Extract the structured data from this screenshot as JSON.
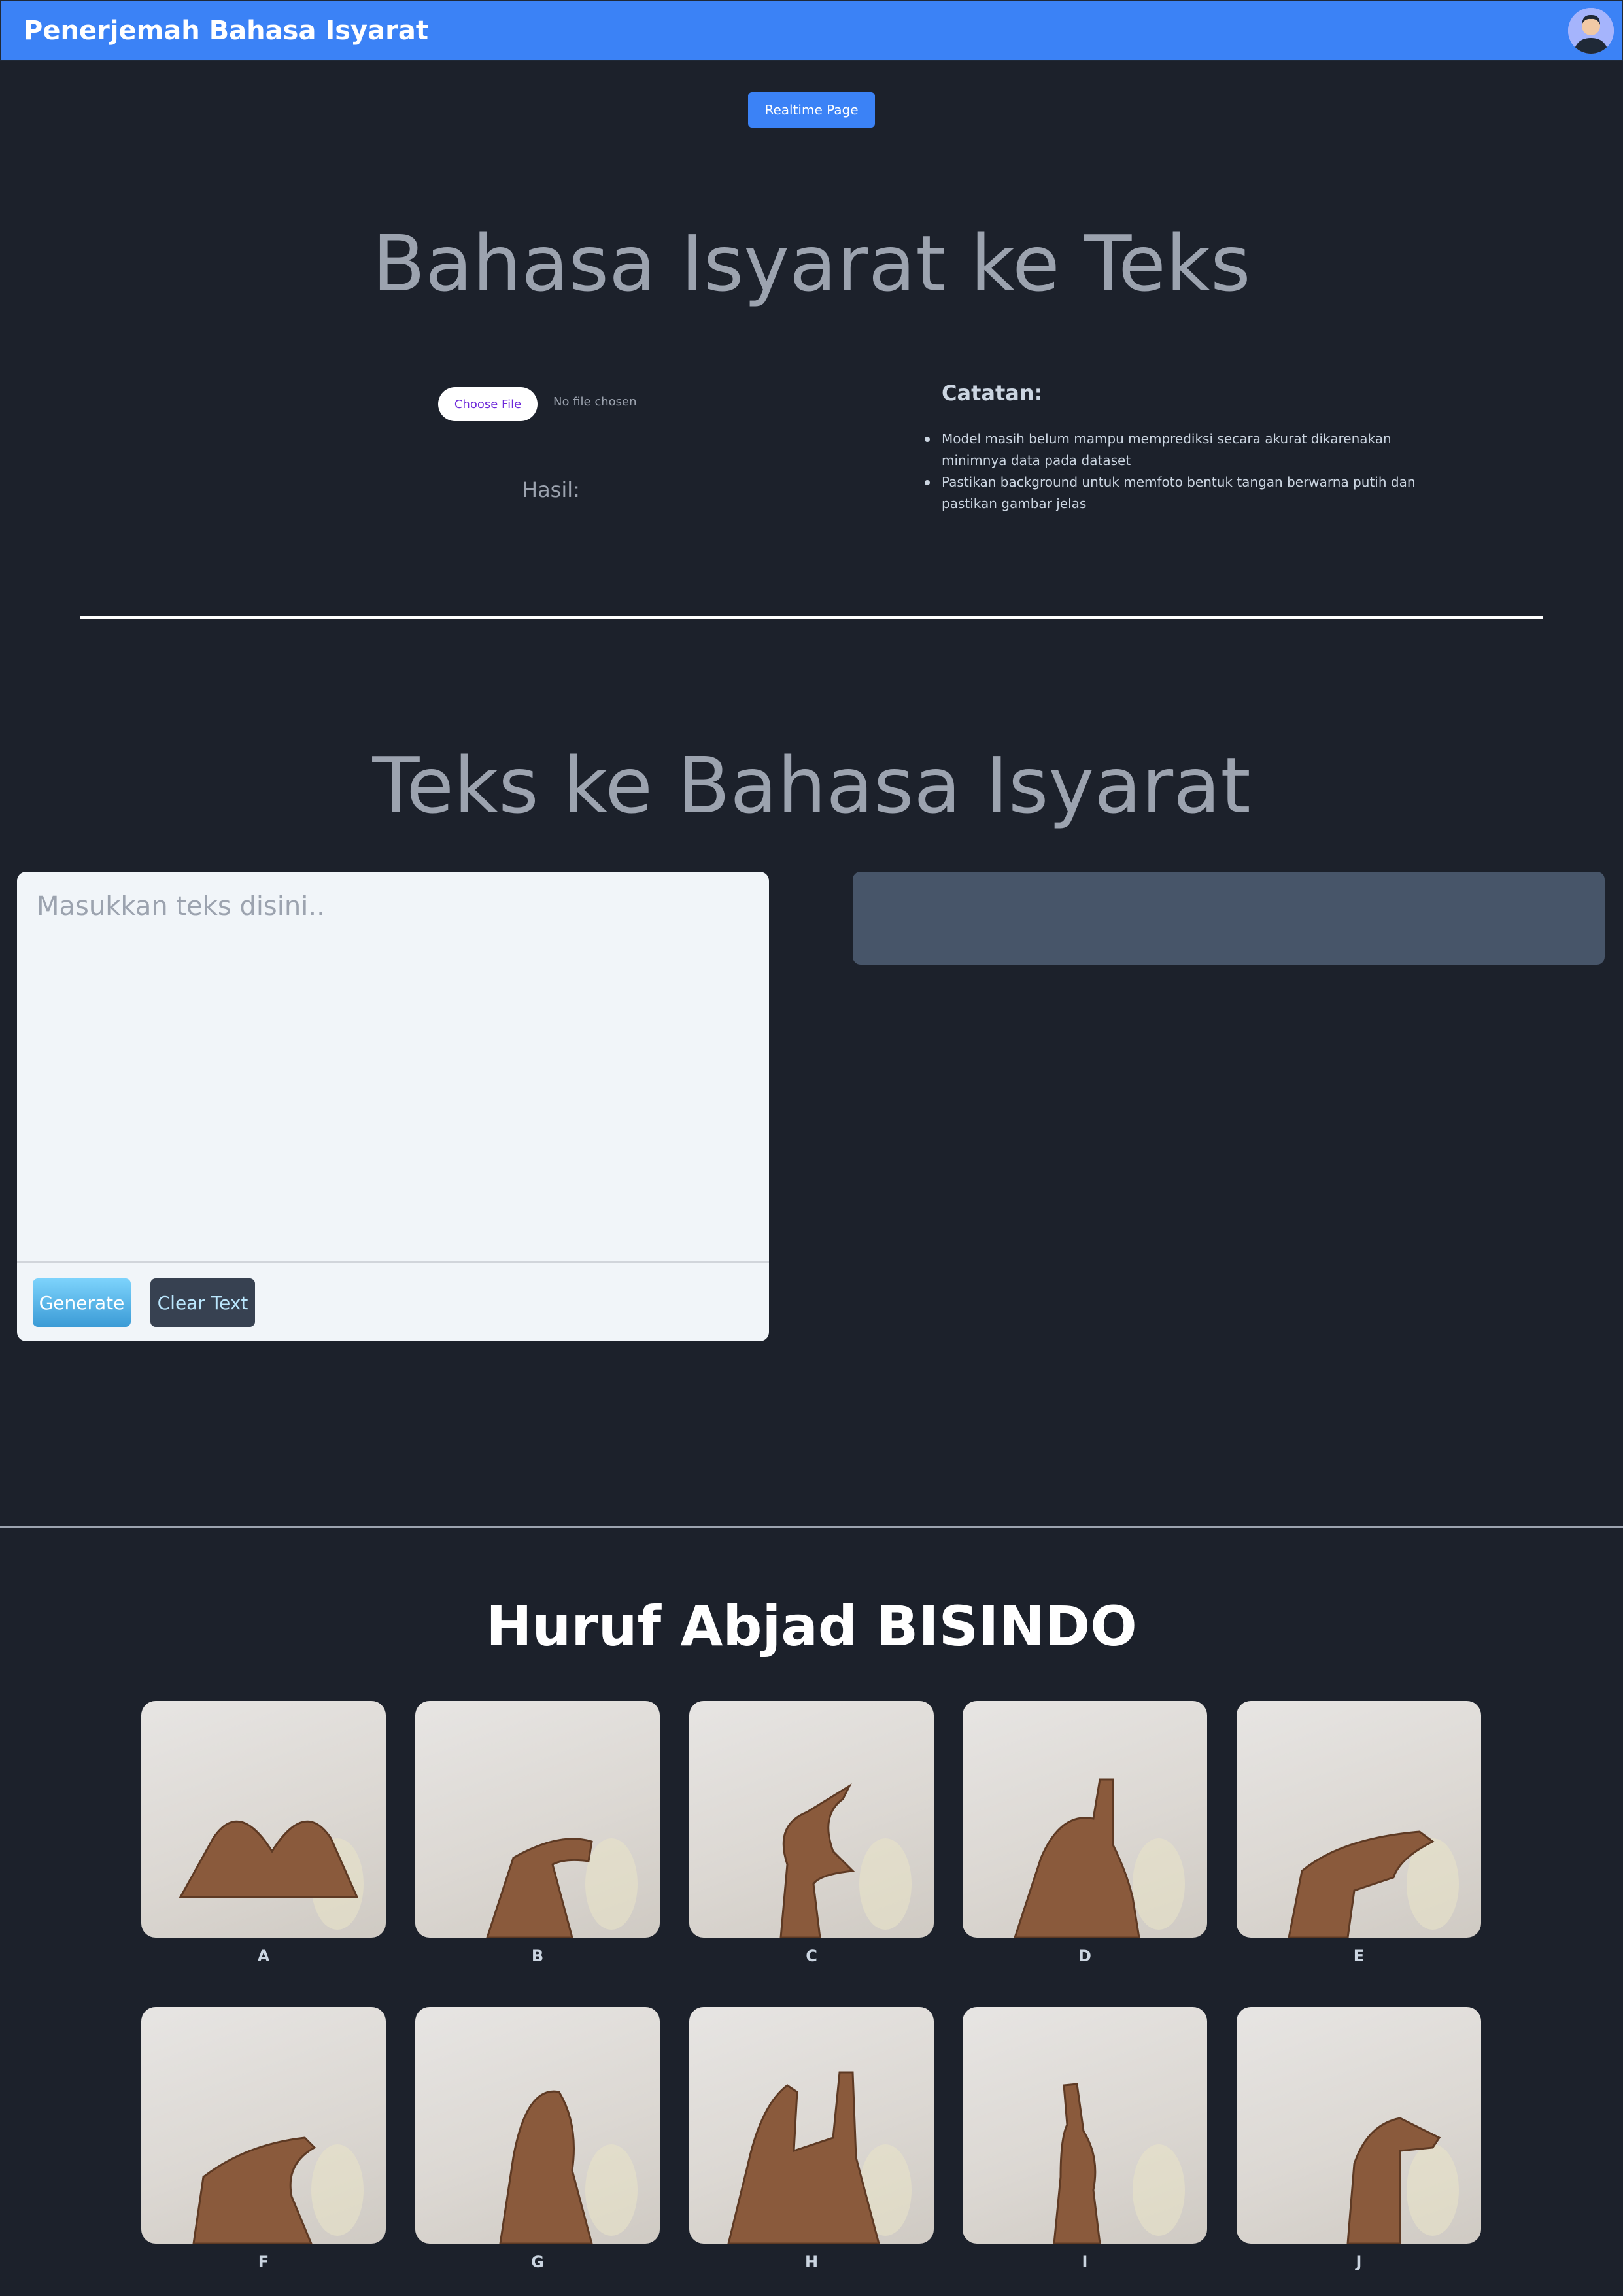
{
  "navbar": {
    "title": "Penerjemah Bahasa Isyarat",
    "avatar_icon": "user-avatar"
  },
  "realtime_button": "Realtime Page",
  "sign_to_text": {
    "title": "Bahasa Isyarat ke Teks",
    "file_button": "Choose File",
    "file_status": "No file chosen",
    "result_label": "Hasil:",
    "notes_title": "Catatan:",
    "notes": [
      "Model masih belum mampu memprediksi secara akurat dikarenakan minimnya data pada dataset",
      "Pastikan background untuk memfoto bentuk tangan berwarna putih dan pastikan gambar jelas"
    ]
  },
  "text_to_sign": {
    "title": "Teks ke Bahasa Isyarat",
    "input_placeholder": "Masukkan teks disini..",
    "generate_label": "Generate",
    "clear_label": "Clear Text"
  },
  "alphabet": {
    "title": "Huruf Abjad BISINDO",
    "letters": [
      "A",
      "B",
      "C",
      "D",
      "E",
      "F",
      "G",
      "H",
      "I",
      "J"
    ]
  },
  "colors": {
    "accent": "#3b82f6",
    "background": "#1c212b",
    "output_box": "#475569"
  }
}
